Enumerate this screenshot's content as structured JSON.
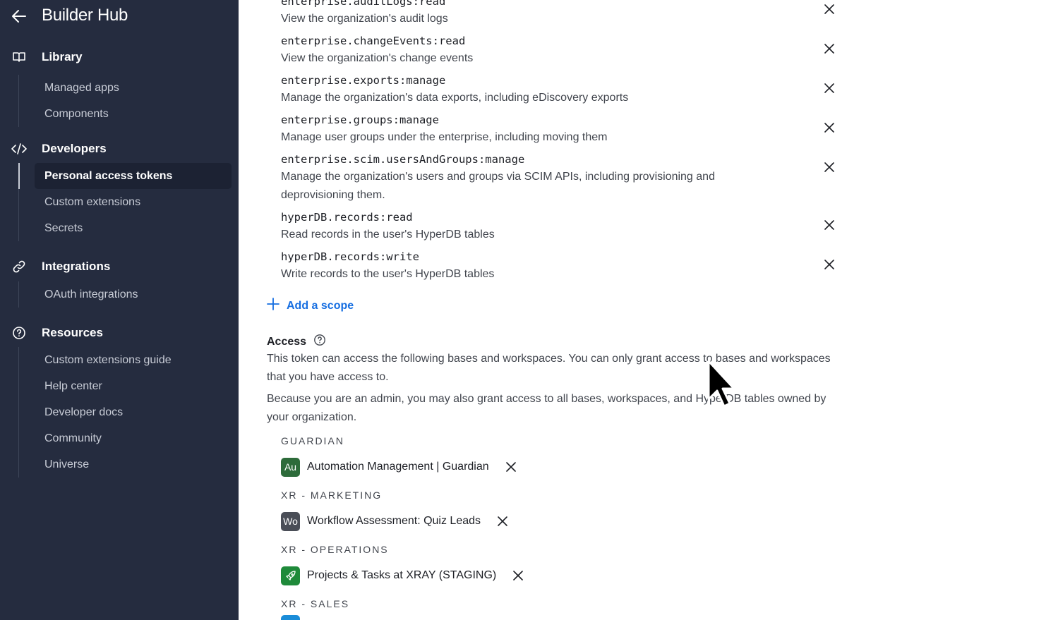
{
  "sidebar": {
    "title": "Builder Hub",
    "sections": [
      {
        "label": "Library",
        "items": [
          "Managed apps",
          "Components"
        ]
      },
      {
        "label": "Developers",
        "items": [
          "Personal access tokens",
          "Custom extensions",
          "Secrets"
        ]
      },
      {
        "label": "Integrations",
        "items": [
          "OAuth integrations"
        ]
      },
      {
        "label": "Resources",
        "items": [
          "Custom extensions guide",
          "Help center",
          "Developer docs",
          "Community",
          "Universe"
        ]
      }
    ],
    "active_item": "Personal access tokens"
  },
  "scopes": [
    {
      "name": "enterprise.auditLogs:read",
      "desc": "View the organization's audit logs"
    },
    {
      "name": "enterprise.changeEvents:read",
      "desc": "View the organization's change events"
    },
    {
      "name": "enterprise.exports:manage",
      "desc": "Manage the organization's data exports, including eDiscovery exports"
    },
    {
      "name": "enterprise.groups:manage",
      "desc": "Manage user groups under the enterprise, including moving them"
    },
    {
      "name": "enterprise.scim.usersAndGroups:manage",
      "desc": "Manage the organization's users and groups via SCIM APIs, including provisioning and deprovisioning them."
    },
    {
      "name": "hyperDB.records:read",
      "desc": "Read records in the user's HyperDB tables"
    },
    {
      "name": "hyperDB.records:write",
      "desc": "Write records to the user's HyperDB tables"
    }
  ],
  "add_scope_label": "Add a scope",
  "access": {
    "heading": "Access",
    "para1": "This token can access the following bases and workspaces. You can only grant access to bases and workspaces that you have access to.",
    "para2": "Because you are an admin, you may also grant access to all bases, workspaces, and HyperDB tables owned by your organization."
  },
  "workspaces": [
    {
      "label": "GUARDIAN",
      "base": {
        "icon_text": "Au",
        "icon_color": "#2d6b3a",
        "name": "Automation Management | Guardian"
      }
    },
    {
      "label": "XR - MARKETING",
      "base": {
        "icon_text": "Wo",
        "icon_color": "#4a4e57",
        "name": "Workflow Assessment: Quiz Leads"
      }
    },
    {
      "label": "XR - OPERATIONS",
      "base": {
        "icon_text": "",
        "icon": "rocket-icon",
        "icon_color": "#1f8a3a",
        "name": "Projects & Tasks at XRAY (STAGING)"
      }
    },
    {
      "label": "XR - SALES"
    }
  ]
}
